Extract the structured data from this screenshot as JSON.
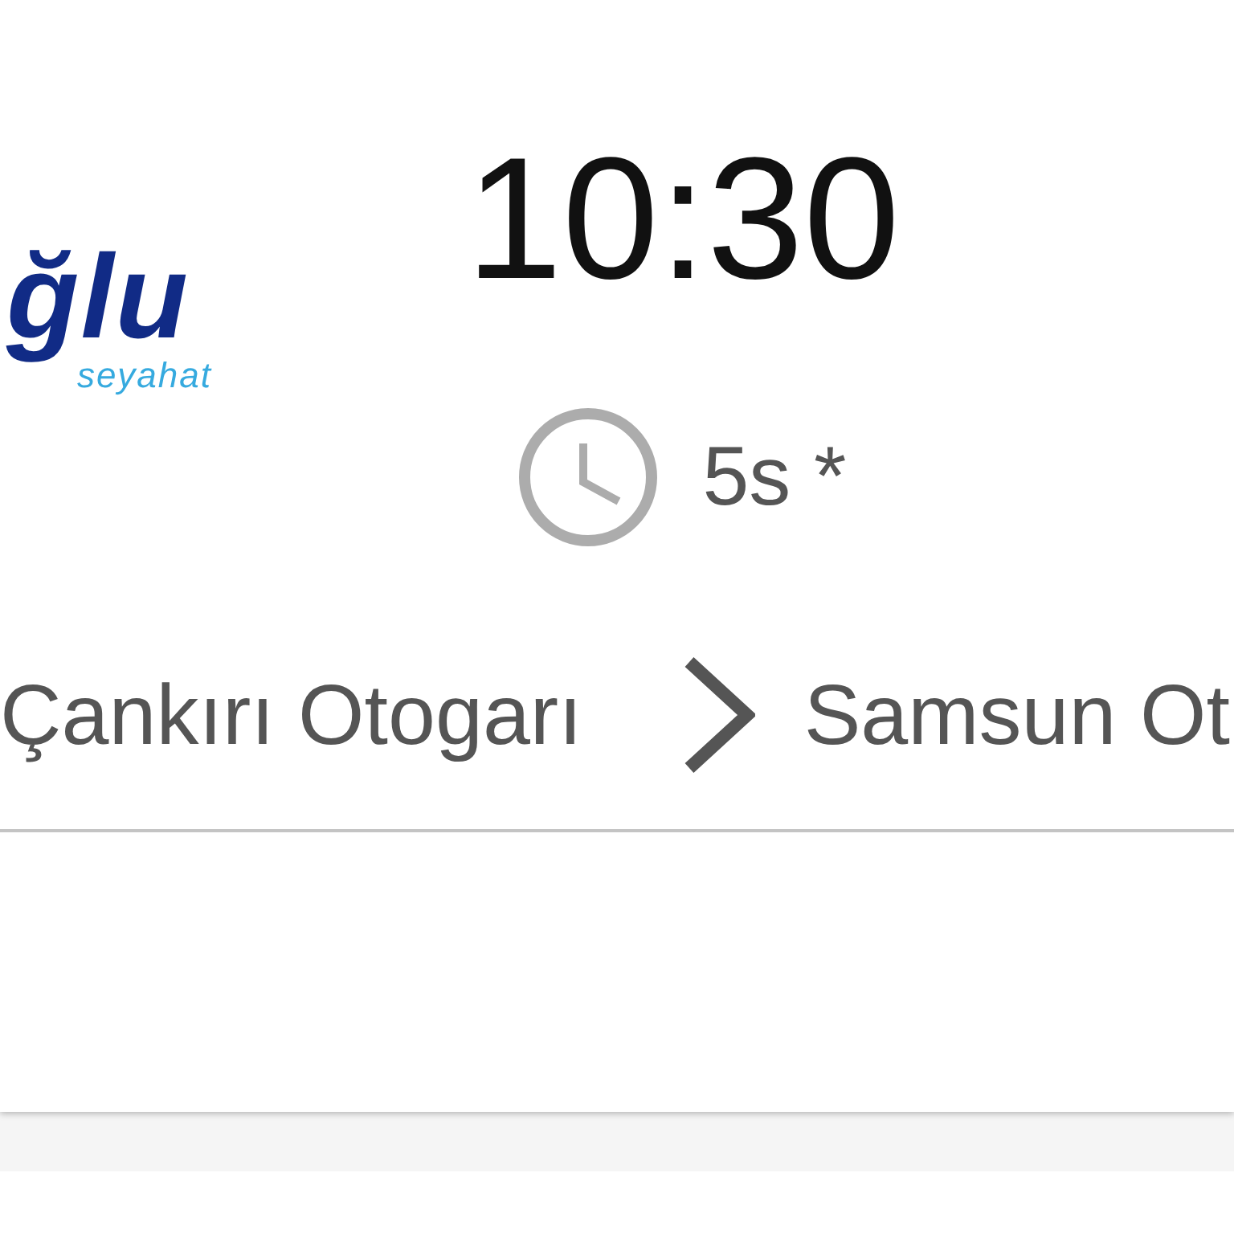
{
  "trip": {
    "logo": {
      "wordmark": "ğlu",
      "tagline": "seyahat"
    },
    "departure_time": "10:30",
    "duration": "5s *",
    "route": {
      "from": "Çankırı Otogarı",
      "to": "Samsun Ot"
    }
  }
}
